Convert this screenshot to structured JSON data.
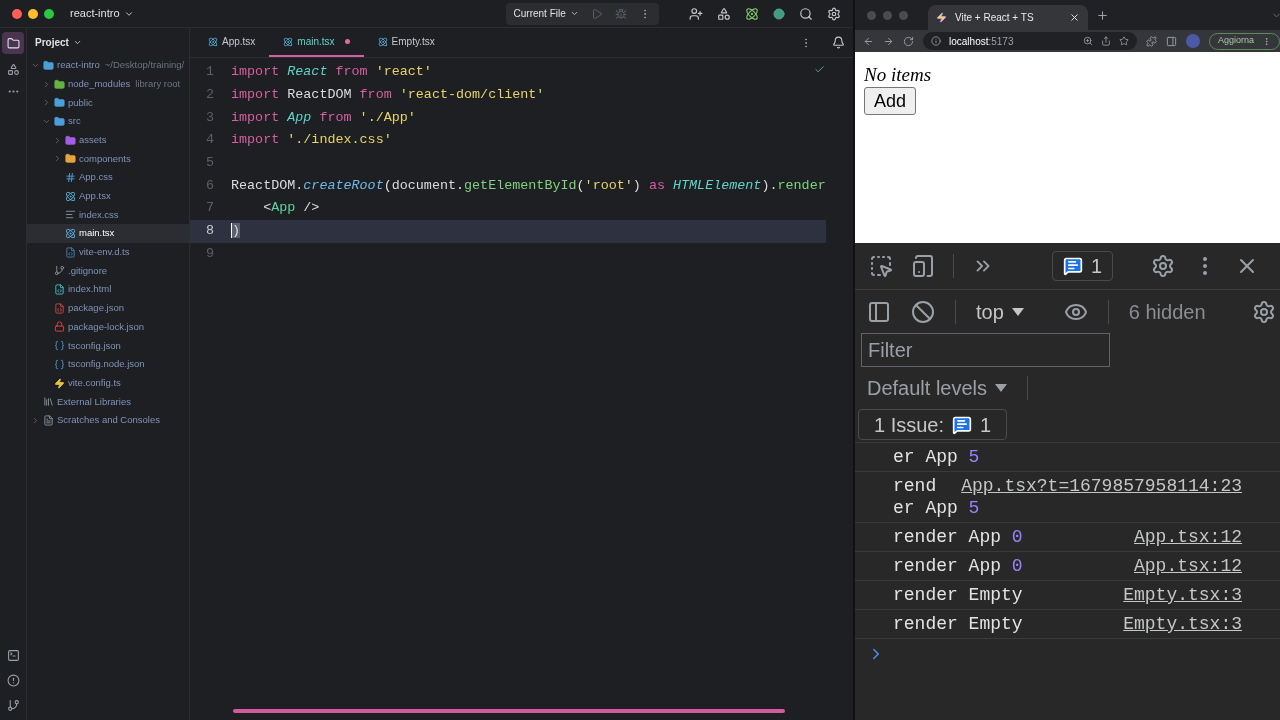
{
  "ide": {
    "project": "react-intro",
    "run_config": "Current File",
    "panel_title": "Project",
    "tree": [
      {
        "name": "react-intro",
        "hint": "~/Desktop/training/",
        "kind": "folder",
        "color": "#4a9fd8",
        "expanded": true,
        "selected": false,
        "children": [
          {
            "name": "node_modules",
            "hint": "library root",
            "kind": "folder",
            "color": "#62b543",
            "expanded": false,
            "selected": false
          },
          {
            "name": "public",
            "kind": "folder",
            "color": "#4a9fd8",
            "expanded": false,
            "selected": false
          },
          {
            "name": "src",
            "kind": "folder",
            "color": "#4a9fd8",
            "expanded": true,
            "selected": false,
            "children": [
              {
                "name": "assets",
                "kind": "folder",
                "color": "#a45ee5",
                "expanded": false,
                "selected": false
              },
              {
                "name": "components",
                "kind": "folder",
                "color": "#e8a33d",
                "expanded": false,
                "selected": false
              },
              {
                "name": "App.css",
                "kind": "css",
                "selected": false
              },
              {
                "name": "App.tsx",
                "kind": "react",
                "selected": false
              },
              {
                "name": "index.css",
                "kind": "css-lines",
                "selected": false
              },
              {
                "name": "main.tsx",
                "kind": "react",
                "selected": true
              },
              {
                "name": "vite-env.d.ts",
                "kind": "ts",
                "selected": false
              }
            ]
          },
          {
            "name": ".gitignore",
            "kind": "git",
            "selected": false
          },
          {
            "name": "index.html",
            "kind": "html",
            "selected": false
          },
          {
            "name": "package.json",
            "kind": "npm",
            "selected": false
          },
          {
            "name": "package-lock.json",
            "kind": "lock",
            "selected": false
          },
          {
            "name": "tsconfig.json",
            "kind": "tsconfig",
            "selected": false
          },
          {
            "name": "tsconfig.node.json",
            "kind": "tsconfig",
            "selected": false
          },
          {
            "name": "vite.config.ts",
            "kind": "vite",
            "selected": false
          }
        ]
      },
      {
        "name": "External Libraries",
        "kind": "library",
        "selected": false
      },
      {
        "name": "Scratches and Consoles",
        "kind": "scratch",
        "expanded": false,
        "selected": false
      }
    ],
    "tabs": [
      {
        "label": "App.tsx",
        "selected": false,
        "modified": false
      },
      {
        "label": "main.tsx",
        "selected": true,
        "modified": true
      },
      {
        "label": "Empty.tsx",
        "selected": false,
        "modified": false
      }
    ],
    "code": [
      {
        "number": "1",
        "current": false,
        "tokens": [
          {
            "kind": "kw",
            "text": "import "
          },
          {
            "kind": "type",
            "text": "React "
          },
          {
            "kind": "kw",
            "text": "from "
          },
          {
            "kind": "str",
            "text": "'react'"
          }
        ]
      },
      {
        "number": "2",
        "current": false,
        "tokens": [
          {
            "kind": "kw",
            "text": "import"
          },
          {
            "kind": "plain",
            "text": " ReactDOM "
          },
          {
            "kind": "kw",
            "text": "from "
          },
          {
            "kind": "str",
            "text": "'react-dom/client'"
          }
        ]
      },
      {
        "number": "3",
        "current": false,
        "tokens": [
          {
            "kind": "kw",
            "text": "import "
          },
          {
            "kind": "type",
            "text": "App "
          },
          {
            "kind": "kw",
            "text": "from "
          },
          {
            "kind": "str",
            "text": "'./App'"
          }
        ]
      },
      {
        "number": "4",
        "current": false,
        "tokens": [
          {
            "kind": "kw",
            "text": "import "
          },
          {
            "kind": "str",
            "text": "'./index.css'"
          }
        ]
      },
      {
        "number": "5",
        "current": false
      },
      {
        "number": "6",
        "current": false,
        "tokens": [
          {
            "kind": "plain",
            "text": "ReactDOM."
          },
          {
            "kind": "fn",
            "text": "createRoot"
          },
          {
            "kind": "plain",
            "text": "(document."
          },
          {
            "kind": "method",
            "text": "getElementById"
          },
          {
            "kind": "plain",
            "text": "("
          },
          {
            "kind": "str",
            "text": "'root'"
          },
          {
            "kind": "plain",
            "text": ") "
          },
          {
            "kind": "kw",
            "text": "as "
          },
          {
            "kind": "type",
            "text": "HTMLElement"
          },
          {
            "kind": "plain",
            "text": ")."
          },
          {
            "kind": "method",
            "text": "render"
          }
        ]
      },
      {
        "number": "7",
        "current": false,
        "tokens": [
          {
            "kind": "plain",
            "text": "    <"
          },
          {
            "kind": "tag",
            "text": "App"
          },
          {
            "kind": "plain",
            "text": " />"
          }
        ]
      },
      {
        "number": "8",
        "current": true,
        "tokens": [
          {
            "kind": "caret",
            "text": ")"
          }
        ]
      },
      {
        "number": "9",
        "current": false
      }
    ]
  },
  "browser": {
    "tab_title": "Vite + React + TS",
    "url_host": "localhost",
    "url_port": ":5173",
    "update_button": "Aggiorna",
    "page": {
      "heading": "No items",
      "button": "Add"
    },
    "devtools": {
      "issues_badge": "1",
      "context": "top",
      "hidden": "6 hidden",
      "filter_placeholder": "Filter",
      "levels": "Default levels",
      "issues_label": "1 Issue:",
      "issues_count": "1",
      "messages": [
        {
          "text": "er App",
          "value": "5"
        },
        {
          "text": "rend",
          "link": "App.tsx?t=1679857958114:23",
          "text2": "er App",
          "value2": "5"
        },
        {
          "text": "render App",
          "value": "0",
          "link": "App.tsx:12"
        },
        {
          "text": "render App",
          "value": "0",
          "link": "App.tsx:12"
        },
        {
          "text": "render Empty",
          "link": "Empty.tsx:3"
        },
        {
          "text": "render Empty",
          "link": "Empty.tsx:3"
        }
      ]
    }
  }
}
